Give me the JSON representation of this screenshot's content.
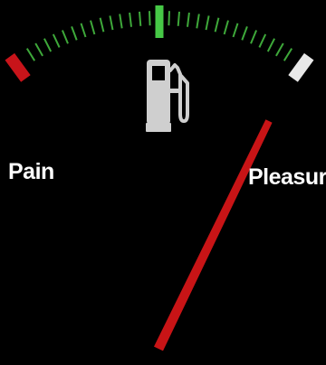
{
  "gauge": {
    "left_label": "Pain",
    "right_label": "Pleasure",
    "icon": "fuel-pump-icon",
    "needle_value": 1.0,
    "colors": {
      "background": "#000000",
      "tick": "#3ea83a",
      "center_tick": "#46c846",
      "empty_marker": "#c8141a",
      "full_marker": "#e8e8e8",
      "needle": "#c81416",
      "icon": "#cfcfcf",
      "label": "#ffffff"
    }
  }
}
